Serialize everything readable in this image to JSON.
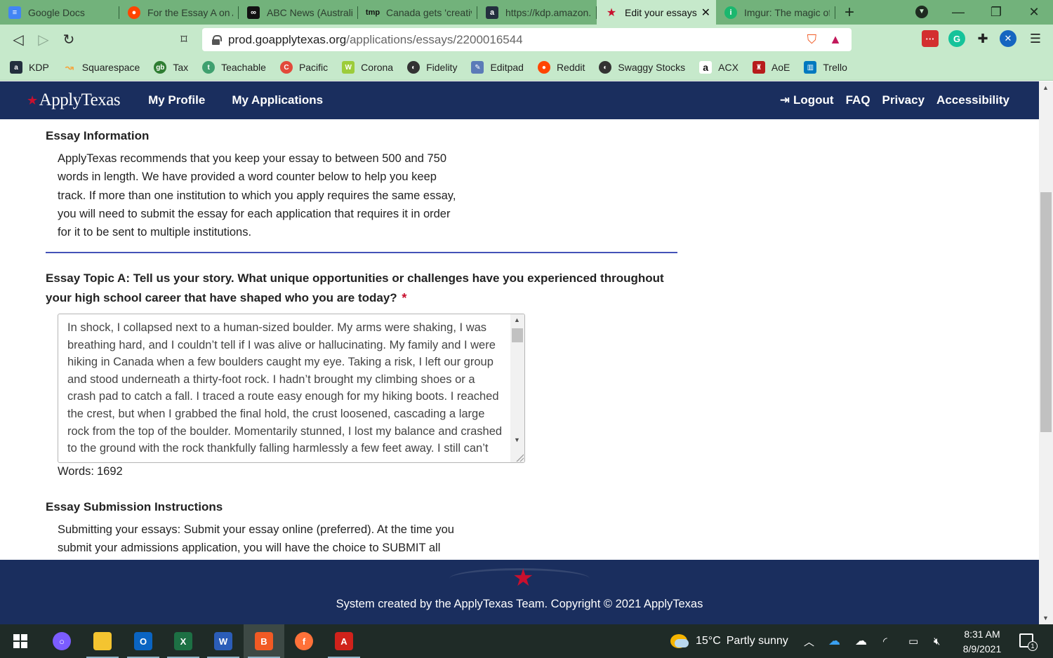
{
  "browser": {
    "tabs": [
      {
        "title": "Google Docs",
        "icon": "google-docs-icon",
        "color": "#4285f4"
      },
      {
        "title": "For the Essay A on A",
        "icon": "reddit-icon",
        "color": "#ff4500"
      },
      {
        "title": "ABC News (Australia",
        "icon": "abc-news-icon",
        "color": "#111111"
      },
      {
        "title": "Canada gets 'creativ",
        "icon": "tmp-icon",
        "color": "#111111"
      },
      {
        "title": "https://kdp.amazon.",
        "icon": "amazon-kdp-icon",
        "color": "#232f3e"
      },
      {
        "title": "Edit your essays",
        "icon": "star-icon",
        "color": "#c8102e",
        "active": true
      },
      {
        "title": "Imgur: The magic of",
        "icon": "imgur-icon",
        "color": "#1bb76e"
      }
    ],
    "url_host": "prod.goapplytexas.org",
    "url_path": "/applications/essays/2200016544",
    "bookmarks": [
      {
        "label": "KDP",
        "icon": "kdp-icon",
        "color": "#232f3e"
      },
      {
        "label": "Squarespace",
        "icon": "squarespace-icon",
        "color": "#f4a742"
      },
      {
        "label": "Tax",
        "icon": "tax-icon",
        "color": "#2e7d32"
      },
      {
        "label": "Teachable",
        "icon": "teachable-icon",
        "color": "#3fa06f"
      },
      {
        "label": "Pacific",
        "icon": "pacific-icon",
        "color": "#e24a3b"
      },
      {
        "label": "Corona",
        "icon": "corona-icon",
        "color": "#9ccc3a"
      },
      {
        "label": "Fidelity",
        "icon": "globe-icon",
        "color": "#333333"
      },
      {
        "label": "Editpad",
        "icon": "editpad-icon",
        "color": "#5b7bb8"
      },
      {
        "label": "Reddit",
        "icon": "reddit-icon",
        "color": "#ff4500"
      },
      {
        "label": "Swaggy Stocks",
        "icon": "globe-icon",
        "color": "#333333"
      },
      {
        "label": "ACX",
        "icon": "amazon-icon",
        "color": "#222222"
      },
      {
        "label": "AoE",
        "icon": "aoe-icon",
        "color": "#b71c1c"
      },
      {
        "label": "Trello",
        "icon": "trello-icon",
        "color": "#0079bf"
      }
    ]
  },
  "site": {
    "logo": "ApplyTexas",
    "nav": [
      "My Profile",
      "My Applications"
    ],
    "right_nav": {
      "logout": "Logout",
      "faq": "FAQ",
      "privacy": "Privacy",
      "accessibility": "Accessibility"
    },
    "brand_color": "#1a2e5e",
    "accent_color": "#c8102e"
  },
  "content": {
    "essay_info_title": "Essay Information",
    "essay_info_text": "ApplyTexas recommends that you keep your essay to between 500 and 750 words in length. We have provided a word counter below to help you keep track. If more than one institution to which you apply requires the same essay, you will need to submit the essay for each application that requires it in order for it to be sent to multiple institutions.",
    "topic_label": "Essay Topic A: Tell us your story. What unique opportunities or challenges have you experienced throughout your high school career that have shaped who you are today?",
    "required_mark": "*",
    "essay_text": "In shock, I collapsed next to a human-sized boulder. My arms were shaking, I was breathing hard, and I couldn’t tell if I was alive or hallucinating. My family and I were hiking in Canada when a few boulders caught my eye. Taking a risk, I left our group and stood underneath a thirty-foot rock. I hadn’t brought my climbing shoes or a crash pad to catch a fall. I traced a route easy enough for my hiking boots. I reached the crest, but when I grabbed the final hold, the crust loosened, cascading a large rock from the top of the boulder. Momentarily stunned, I lost my balance and crashed to the ground with the rock thankfully falling harmlessly a few feet away. I still can’t",
    "words_label": "Words:",
    "words_count": "1692",
    "submission_title": "Essay Submission Instructions",
    "submission_text": "Submitting your essays: Submit your essay online (preferred). At the time you submit your admissions application, you will have the choice to SUBMIT all"
  },
  "footer": {
    "text": "System created by the ApplyTexas Team. Copyright © 2021 ApplyTexas"
  },
  "taskbar": {
    "weather_temp": "15°C",
    "weather_desc": "Partly sunny",
    "time": "8:31 AM",
    "date": "8/9/2021",
    "notifications": "1"
  }
}
